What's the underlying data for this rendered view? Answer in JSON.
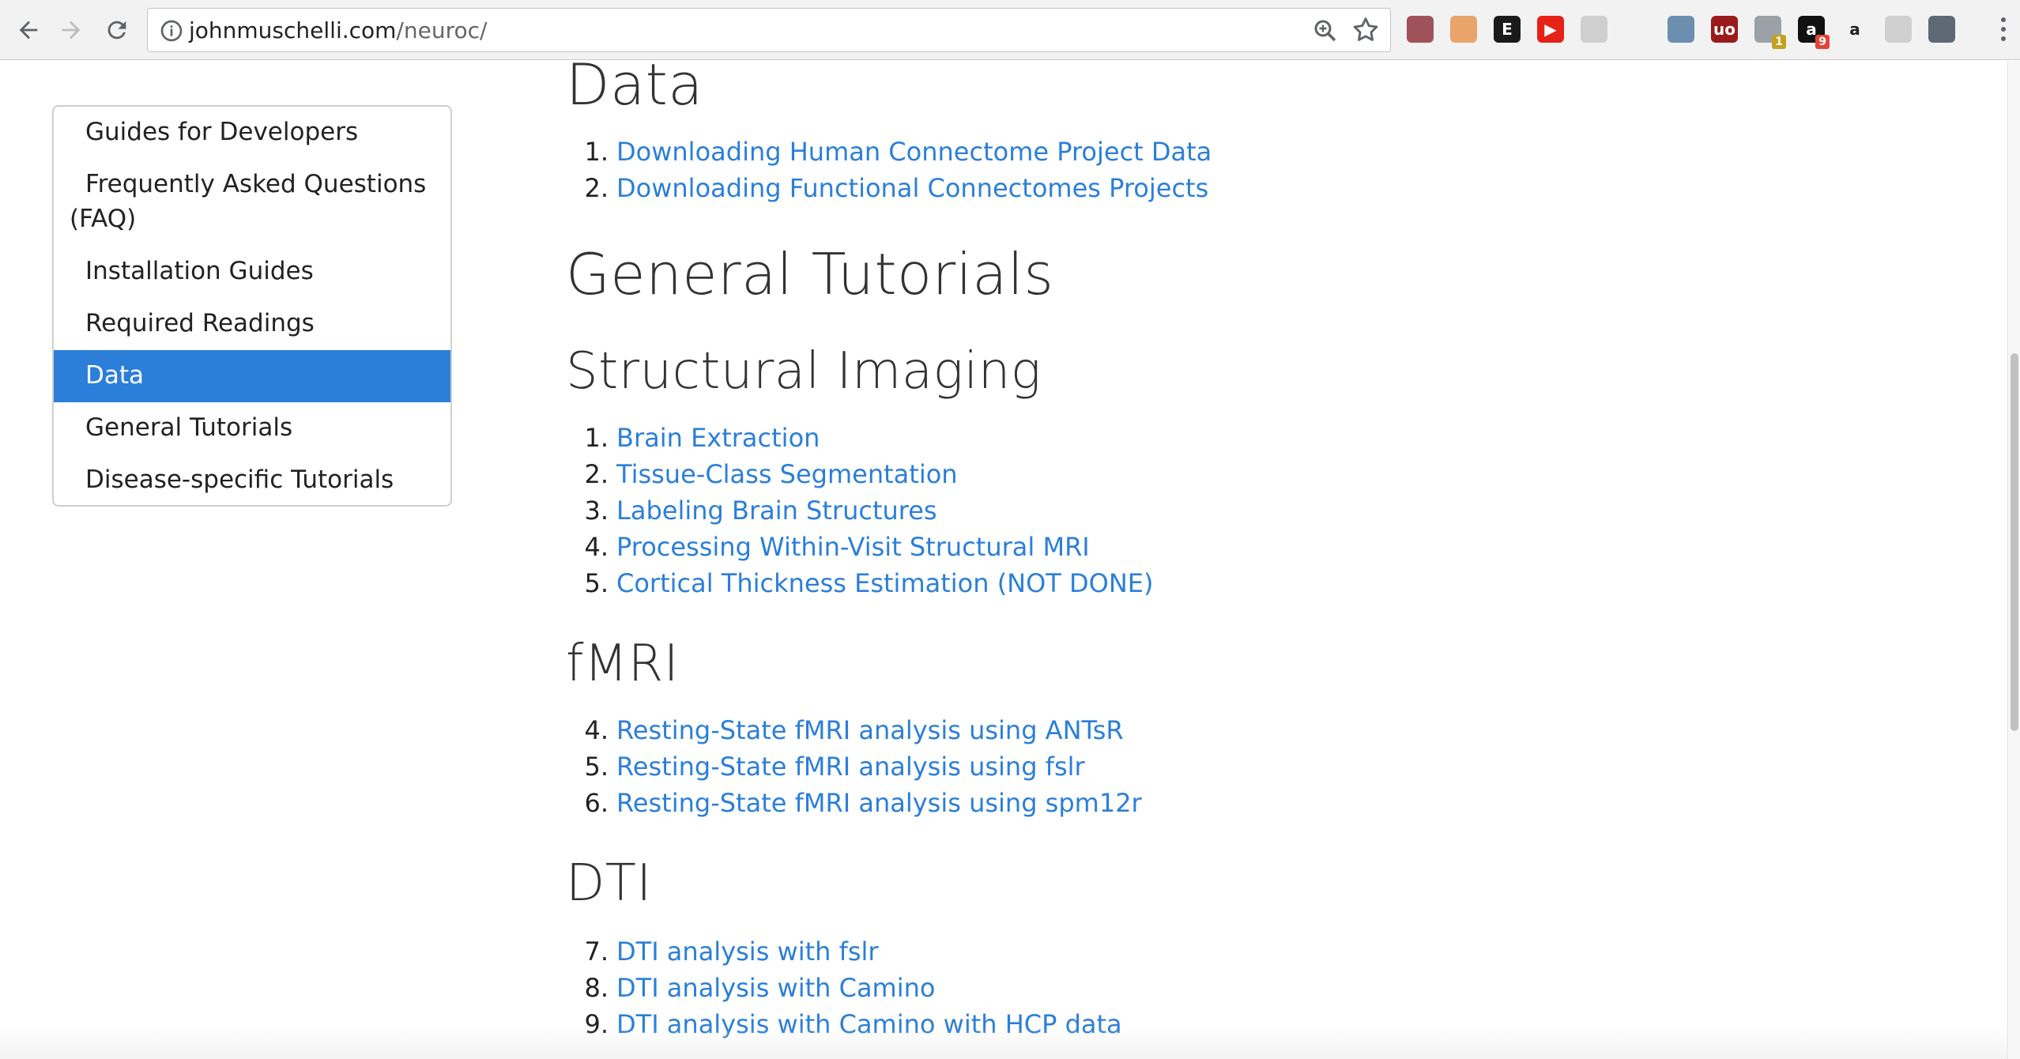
{
  "browser": {
    "url_host": "johnmuschelli.com",
    "url_path": "/neuroc/",
    "extensions": [
      {
        "icon": "tomato-extension-icon",
        "color": "#a0525b",
        "label": ""
      },
      {
        "icon": "honey-extension-icon",
        "color": "#e8a46a",
        "label": ""
      },
      {
        "icon": "evernote-extension-icon",
        "color": "#1a1a1a",
        "label": "E"
      },
      {
        "icon": "youtube-extension-icon",
        "color": "#e62117",
        "label": "▶"
      },
      {
        "icon": "search-extension-icon",
        "color": "#cfcfcf",
        "label": ""
      },
      {
        "icon": "cast-icon",
        "color": "#f2f2f2",
        "label": ""
      },
      {
        "icon": "satellite-extension-icon",
        "color": "#6c8fb0",
        "label": ""
      },
      {
        "icon": "ublock-icon",
        "color": "#9b1b1b",
        "label": "uo"
      },
      {
        "icon": "people-extension-icon",
        "color": "#9aa2a8",
        "label": "",
        "badge": "1",
        "badge_color": "#c4a11f"
      },
      {
        "icon": "a-extension-icon",
        "color": "#111111",
        "label": "a",
        "badge": "9",
        "badge_color": "#e3443a"
      },
      {
        "icon": "amazon-icon",
        "color": "#f2f2f2",
        "label": "a"
      },
      {
        "icon": "chat-extension-icon",
        "color": "#d0d0d0",
        "label": ""
      },
      {
        "icon": "eye-extension-icon",
        "color": "#5d6a75",
        "label": ""
      }
    ]
  },
  "sidebar": {
    "items": [
      {
        "label": "Guides for Developers",
        "active": false
      },
      {
        "label": "Frequently Asked Questions (FAQ)",
        "active": false
      },
      {
        "label": "Installation Guides",
        "active": false
      },
      {
        "label": "Required Readings",
        "active": false
      },
      {
        "label": "Data",
        "active": true
      },
      {
        "label": "General Tutorials",
        "active": false
      },
      {
        "label": "Disease-specific Tutorials",
        "active": false
      }
    ]
  },
  "main": {
    "data_heading": "Data",
    "data_items": [
      {
        "num": "1.",
        "label": "Downloading Human Connectome Project Data"
      },
      {
        "num": "2.",
        "label": "Downloading Functional Connectomes Projects"
      }
    ],
    "general_heading": "General Tutorials",
    "structural_heading": "Structural Imaging",
    "structural_items": [
      {
        "num": "1.",
        "label": "Brain Extraction"
      },
      {
        "num": "2.",
        "label": "Tissue-Class Segmentation"
      },
      {
        "num": "3.",
        "label": "Labeling Brain Structures"
      },
      {
        "num": "4.",
        "label": "Processing Within-Visit Structural MRI"
      },
      {
        "num": "5.",
        "label": "Cortical Thickness Estimation (NOT DONE)"
      }
    ],
    "fmri_heading": "fMRI",
    "fmri_items": [
      {
        "num": "4.",
        "label": "Resting-State fMRI analysis using ANTsR"
      },
      {
        "num": "5.",
        "label": "Resting-State fMRI analysis using fslr"
      },
      {
        "num": "6.",
        "label": "Resting-State fMRI analysis using spm12r"
      }
    ],
    "dti_heading": "DTI",
    "dti_items": [
      {
        "num": "7.",
        "label": "DTI analysis with fslr"
      },
      {
        "num": "8.",
        "label": "DTI analysis with Camino"
      },
      {
        "num": "9.",
        "label": "DTI analysis with Camino with HCP data"
      }
    ]
  },
  "colors": {
    "link": "#2b7fd8",
    "active_nav": "#2b7fd8"
  }
}
